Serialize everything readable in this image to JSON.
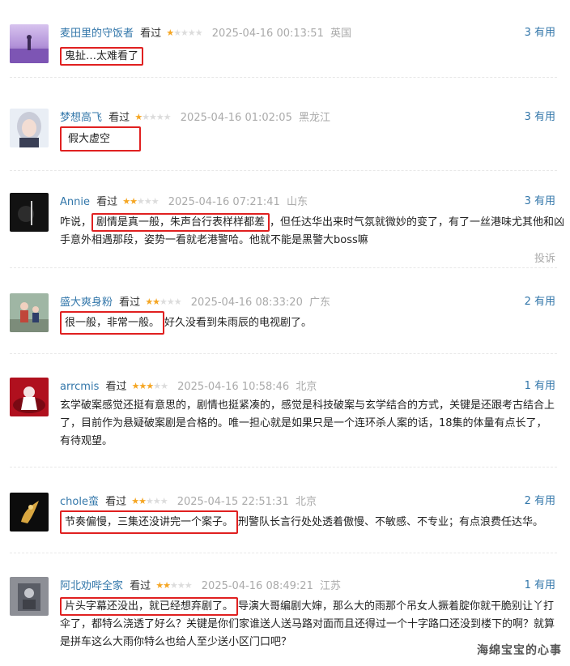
{
  "reviews": [
    {
      "user": "麦田里的守饭者",
      "watched": "看过",
      "stars_on": "★",
      "stars_off": "★★★★",
      "time": "2025-04-16 00:13:51",
      "location": "英国",
      "useful": "3 有用",
      "highlight": "鬼扯…太难看了",
      "line1": "",
      "line2": "",
      "line3": ""
    },
    {
      "user": "梦想高飞",
      "watched": "看过",
      "stars_on": "★",
      "stars_off": "★★★★",
      "time": "2025-04-16 01:02:05",
      "location": "黑龙江",
      "useful": "3 有用",
      "highlight": "假大虚空",
      "line1": "",
      "line2": "",
      "line3": ""
    },
    {
      "user": "Annie",
      "watched": "看过",
      "stars_on": "★★",
      "stars_off": "★★★",
      "time": "2025-04-16 07:21:41",
      "location": "山东",
      "useful": "3 有用",
      "prefix": "咋说，",
      "highlight": "剧情是真一般，朱声台行表样样都差",
      "line1": "，但任达华出来时气氛就微妙的变了，有了一丝港味尤其他和凶",
      "line2": "手意外相遇那段，姿势一看就老港警哈。他就不能是黑警大boss嘛",
      "line3": "",
      "report": "投诉"
    },
    {
      "user": "盛大爽身粉",
      "watched": "看过",
      "stars_on": "★★",
      "stars_off": "★★★",
      "time": "2025-04-16 08:33:20",
      "location": "广东",
      "useful": "2 有用",
      "highlight": "很一般，非常一般。",
      "line1": "好久没看到朱雨辰的电视剧了。",
      "line2": "",
      "line3": ""
    },
    {
      "user": "arrcmis",
      "watched": "看过",
      "stars_on": "★★★",
      "stars_off": "★★",
      "time": "2025-04-16 10:58:46",
      "location": "北京",
      "useful": "1 有用",
      "highlight": "",
      "line1": "玄学破案感觉还挺有意思的，剧情也挺紧凑的，感觉是科技破案与玄学结合的方式，关键是还跟考古结合上",
      "line2": "了，目前作为悬疑破案剧是合格的。唯一担心就是如果只是一个连环杀人案的话，18集的体量有点长了，",
      "line3": "有待观望。"
    },
    {
      "user": "chole蛮",
      "watched": "看过",
      "stars_on": "★★",
      "stars_off": "★★★",
      "time": "2025-04-15 22:51:31",
      "location": "北京",
      "useful": "2 有用",
      "highlight": "节奏偏慢，三集还没讲完一个案子。",
      "line1": "刑警队长言行处处透着傲慢、不敏感、不专业；有点浪费任达华。",
      "line2": "",
      "line3": ""
    },
    {
      "user": "阿北劝哔全家",
      "watched": "看过",
      "stars_on": "★★",
      "stars_off": "★★★",
      "time": "2025-04-16 08:49:21",
      "location": "江苏",
      "useful": "1 有用",
      "highlight": "片头字幕还没出，就已经想弃剧了。",
      "line1": "导演大哥编剧大婶，那么大的雨那个吊女人撅着腚你就干脆别让丫打",
      "line2": "伞了，都特么浇透了好么？关键是你们家谁送人送马路对面而且还得过一个十字路口还没到楼下的啊？就算",
      "line3": "是拼车这么大雨你特么也给人至少送小区门口吧？"
    }
  ],
  "watermark": "海绵宝宝的心事"
}
